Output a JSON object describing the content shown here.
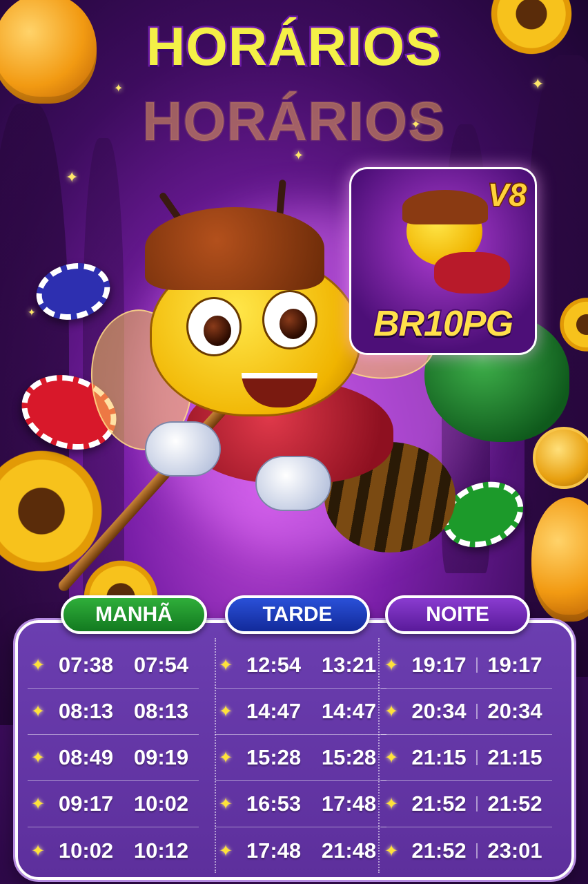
{
  "title": "HORÁRIOS",
  "title_echo": "HORÁRIOS",
  "logo": {
    "badge": "V8",
    "brand": "BR10PG"
  },
  "schedule": {
    "manha": {
      "label": "MANHÃ",
      "rows": [
        [
          "07:38",
          "07:54"
        ],
        [
          "08:13",
          "08:13"
        ],
        [
          "08:49",
          "09:19"
        ],
        [
          "09:17",
          "10:02"
        ],
        [
          "10:02",
          "10:12"
        ]
      ]
    },
    "tarde": {
      "label": "TARDE",
      "rows": [
        [
          "12:54",
          "13:21"
        ],
        [
          "14:47",
          "14:47"
        ],
        [
          "15:28",
          "15:28"
        ],
        [
          "16:53",
          "17:48"
        ],
        [
          "17:48",
          "21:48"
        ]
      ]
    },
    "noite": {
      "label": "NOITE",
      "rows": [
        [
          "19:17",
          "19:17"
        ],
        [
          "20:34",
          "20:34"
        ],
        [
          "21:15",
          "21:15"
        ],
        [
          "21:52",
          "21:52"
        ],
        [
          "21:52",
          "23:01"
        ]
      ]
    }
  },
  "colors": {
    "manha": "#1f9a2e",
    "tarde": "#1e3fc0",
    "noite": "#7a2cc0",
    "title_fill": "#f4f047",
    "panel": "#6236a6"
  },
  "icons": [
    "sparkle-icon",
    "honey-pot",
    "poker-chip",
    "sunflower",
    "gold-coin",
    "bee-mascot"
  ]
}
